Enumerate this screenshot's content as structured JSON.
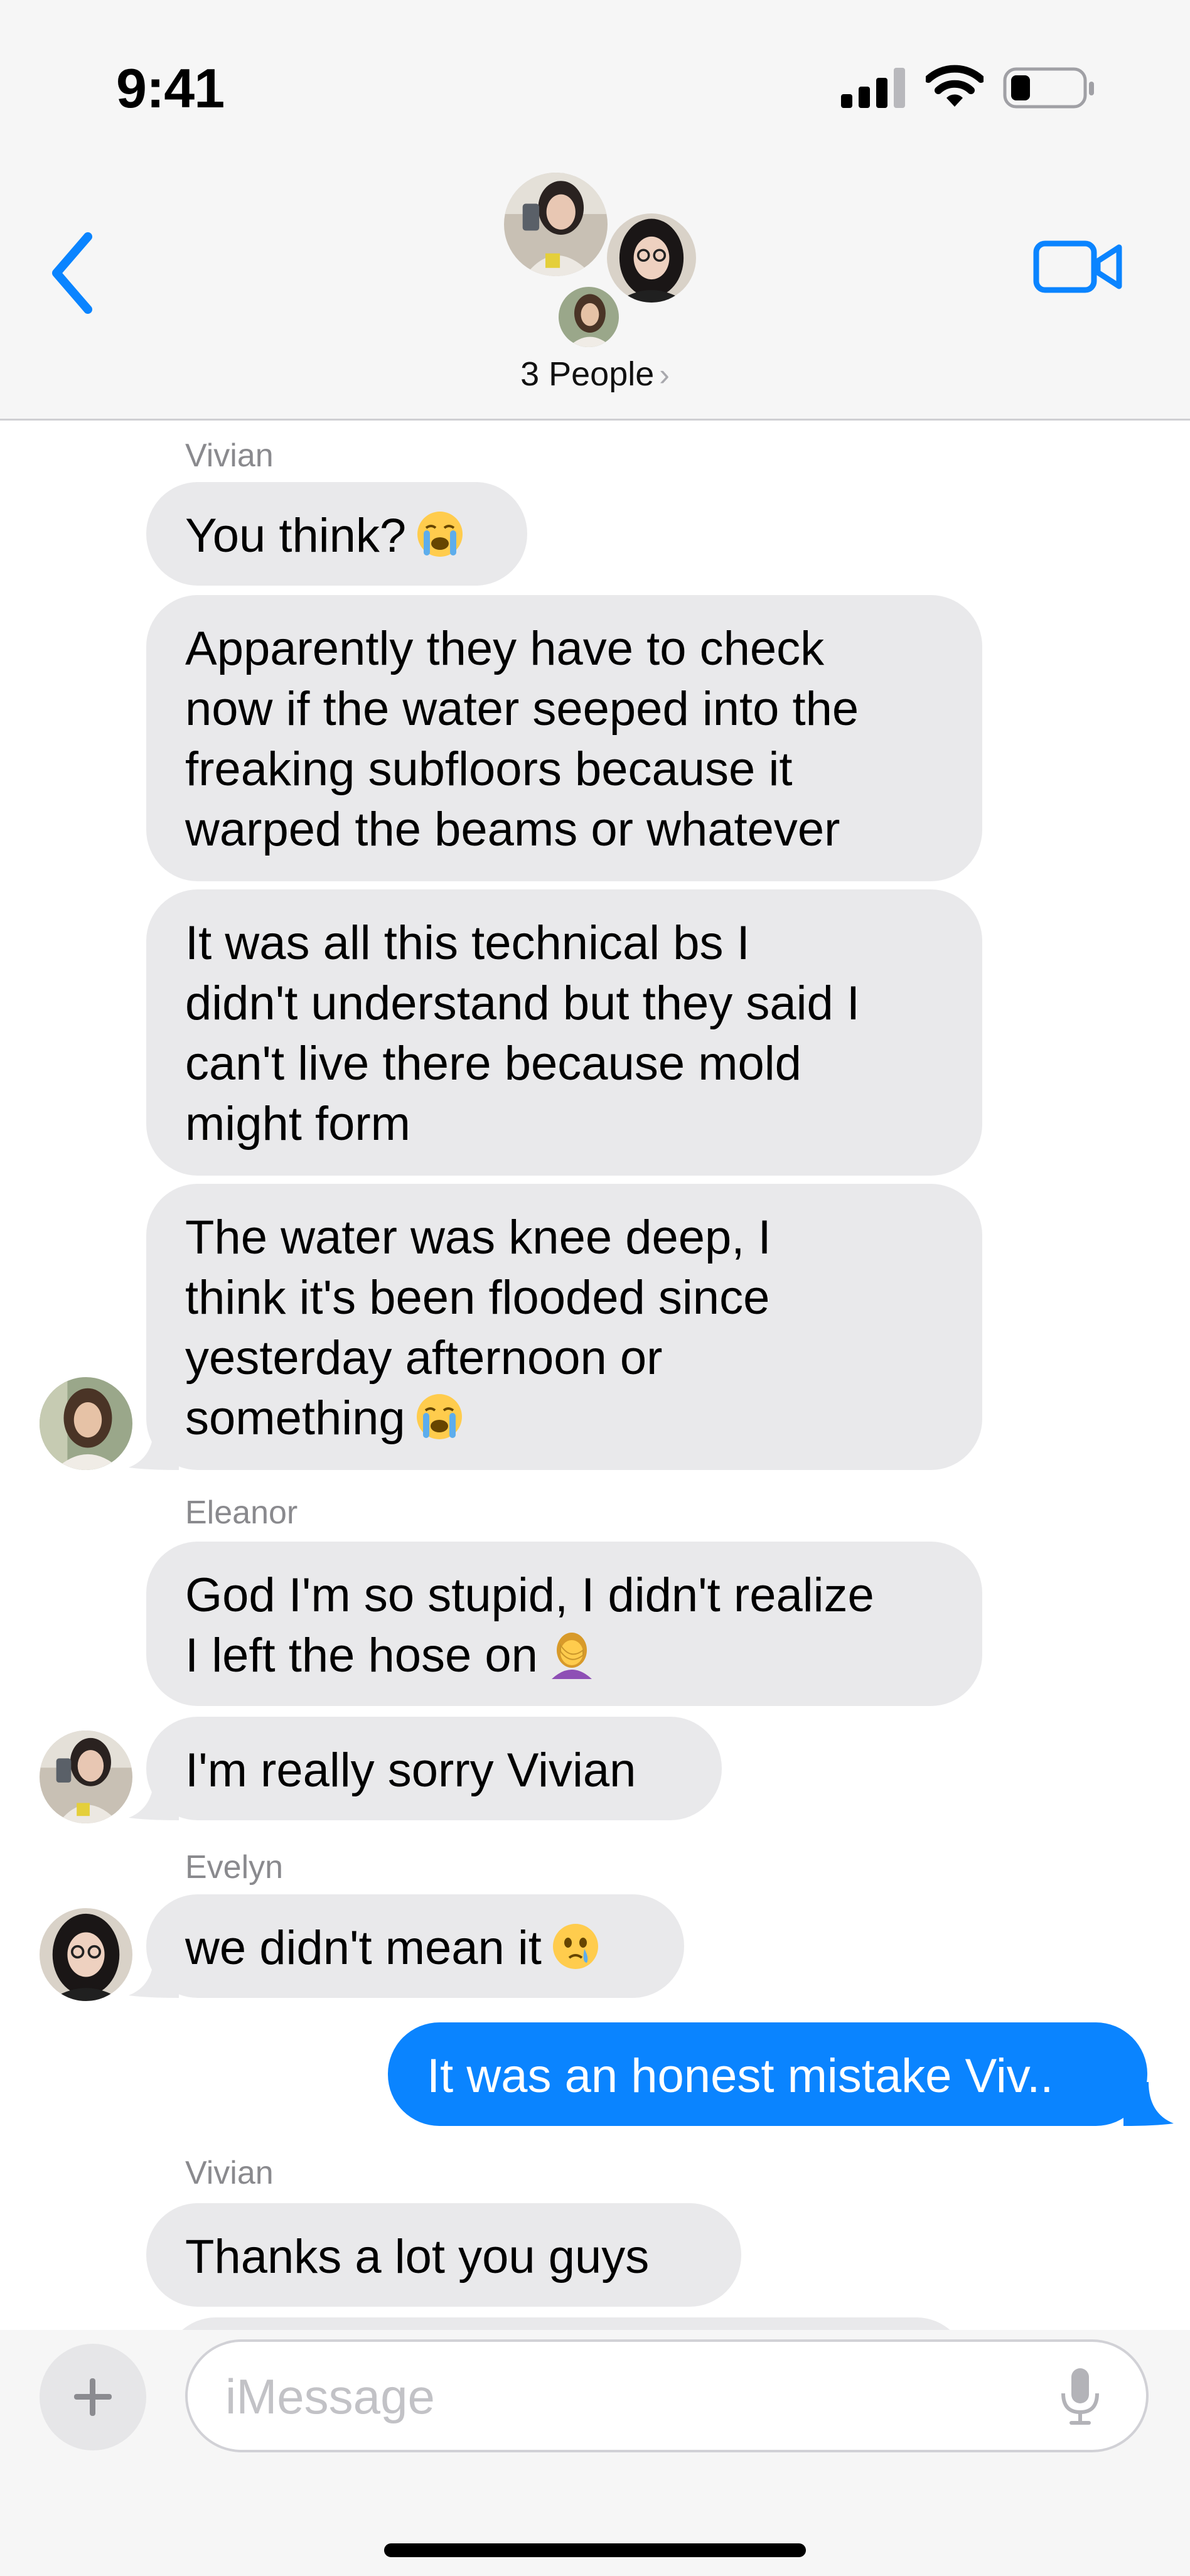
{
  "status_bar": {
    "time": "9:41"
  },
  "header": {
    "group_title": "3 People",
    "chevron": "›"
  },
  "icons": {
    "back": "chevron-left-icon",
    "video": "video-camera-icon",
    "signal": "cellular-signal-icon",
    "wifi": "wifi-icon",
    "battery": "battery-icon",
    "plus": "plus-icon",
    "mic": "microphone-icon"
  },
  "colors": {
    "accent": "#0a84ff",
    "incoming_bubble": "#e9e9eb",
    "sender_label": "#8a8a8e",
    "bar_background": "#f6f6f6"
  },
  "conversation": [
    {
      "sender": "Vivian"
    },
    {
      "text": "You think?",
      "emoji": "loudly-crying-face",
      "direction": "incoming"
    },
    {
      "text": "Apparently they have to check now if the water seeped into the freaking subfloors because it warped the beams or whatever",
      "direction": "incoming"
    },
    {
      "text": "It was all this technical bs I didn't understand but they said I can't live there because mold might form",
      "direction": "incoming"
    },
    {
      "text": "The water was knee deep, I think it's been flooded since yesterday afternoon or something",
      "emoji": "loudly-crying-face",
      "direction": "incoming",
      "avatar": "Vivian"
    },
    {
      "sender": "Eleanor"
    },
    {
      "text": "God I'm so stupid, I didn't realize I left the hose on",
      "emoji": "person-facepalming",
      "direction": "incoming"
    },
    {
      "text": "I'm really sorry Vivian",
      "direction": "incoming",
      "avatar": "Eleanor"
    },
    {
      "sender": "Evelyn"
    },
    {
      "text": "we didn't mean it",
      "emoji": "face-holding-back-tears",
      "direction": "incoming",
      "avatar": "Evelyn"
    },
    {
      "text": "It was an honest mistake Viv..",
      "direction": "outgoing"
    },
    {
      "sender": "Vivian"
    },
    {
      "text": "Thanks a lot you guys",
      "direction": "incoming"
    }
  ],
  "labels": {
    "sender_vivian": "Vivian",
    "sender_eleanor": "Eleanor",
    "sender_evelyn": "Evelyn",
    "sender_vivian_2": "Vivian"
  },
  "messages": {
    "m1": "You think?",
    "m2": "Apparently they have to check\nnow if the water seeped into the\nfreaking subfloors because it\nwarped the beams or whatever",
    "m3": "It was all this technical bs I\ndidn't understand but they said I\ncan't live there because mold\nmight form",
    "m4": "The water was knee deep, I\nthink it's been flooded since\nyesterday afternoon or\nsomething",
    "m5": "God I'm so stupid, I didn't realize\nI left the hose on",
    "m6": "I'm really sorry Vivian",
    "m7": "we didn't mean it",
    "m8": "It was an honest mistake Viv..",
    "m9": "Thanks a lot you guys"
  },
  "input": {
    "placeholder": "iMessage"
  }
}
